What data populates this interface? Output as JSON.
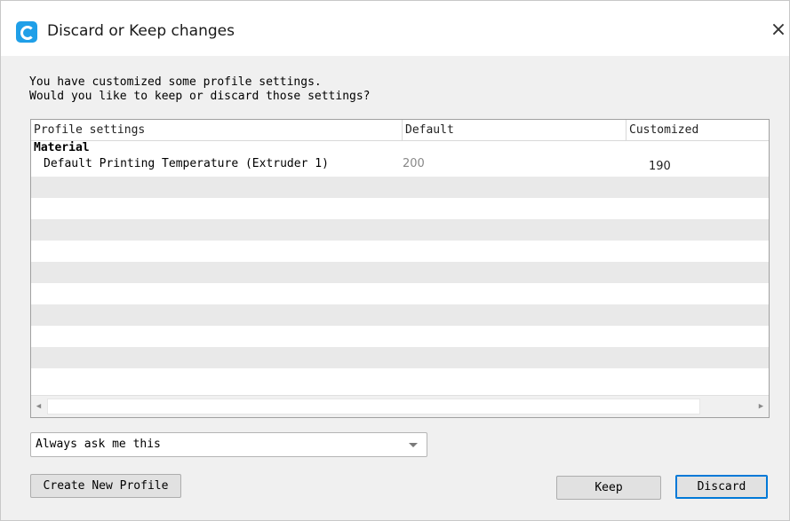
{
  "window": {
    "title": "Discard or Keep changes",
    "icon": "app-logo-icon",
    "close_glyph": "×"
  },
  "message": {
    "line1": "You have customized some profile settings.",
    "line2": "Would you like to keep or discard those settings?"
  },
  "table": {
    "columns": [
      "Profile settings",
      "Default",
      "Customized"
    ],
    "group": "Material",
    "rows": [
      {
        "name": "Default Printing Temperature (Extruder 1)",
        "default": "200",
        "customized": "190"
      }
    ]
  },
  "scrollbar": {
    "left_arrow": "◀",
    "right_arrow": "▶"
  },
  "dropdown": {
    "selected": "Always ask me this"
  },
  "buttons": {
    "create": "Create New Profile",
    "keep": "Keep",
    "discard": "Discard"
  },
  "colors": {
    "accent": "#0078d7",
    "app_icon": "#1f9fe8"
  }
}
